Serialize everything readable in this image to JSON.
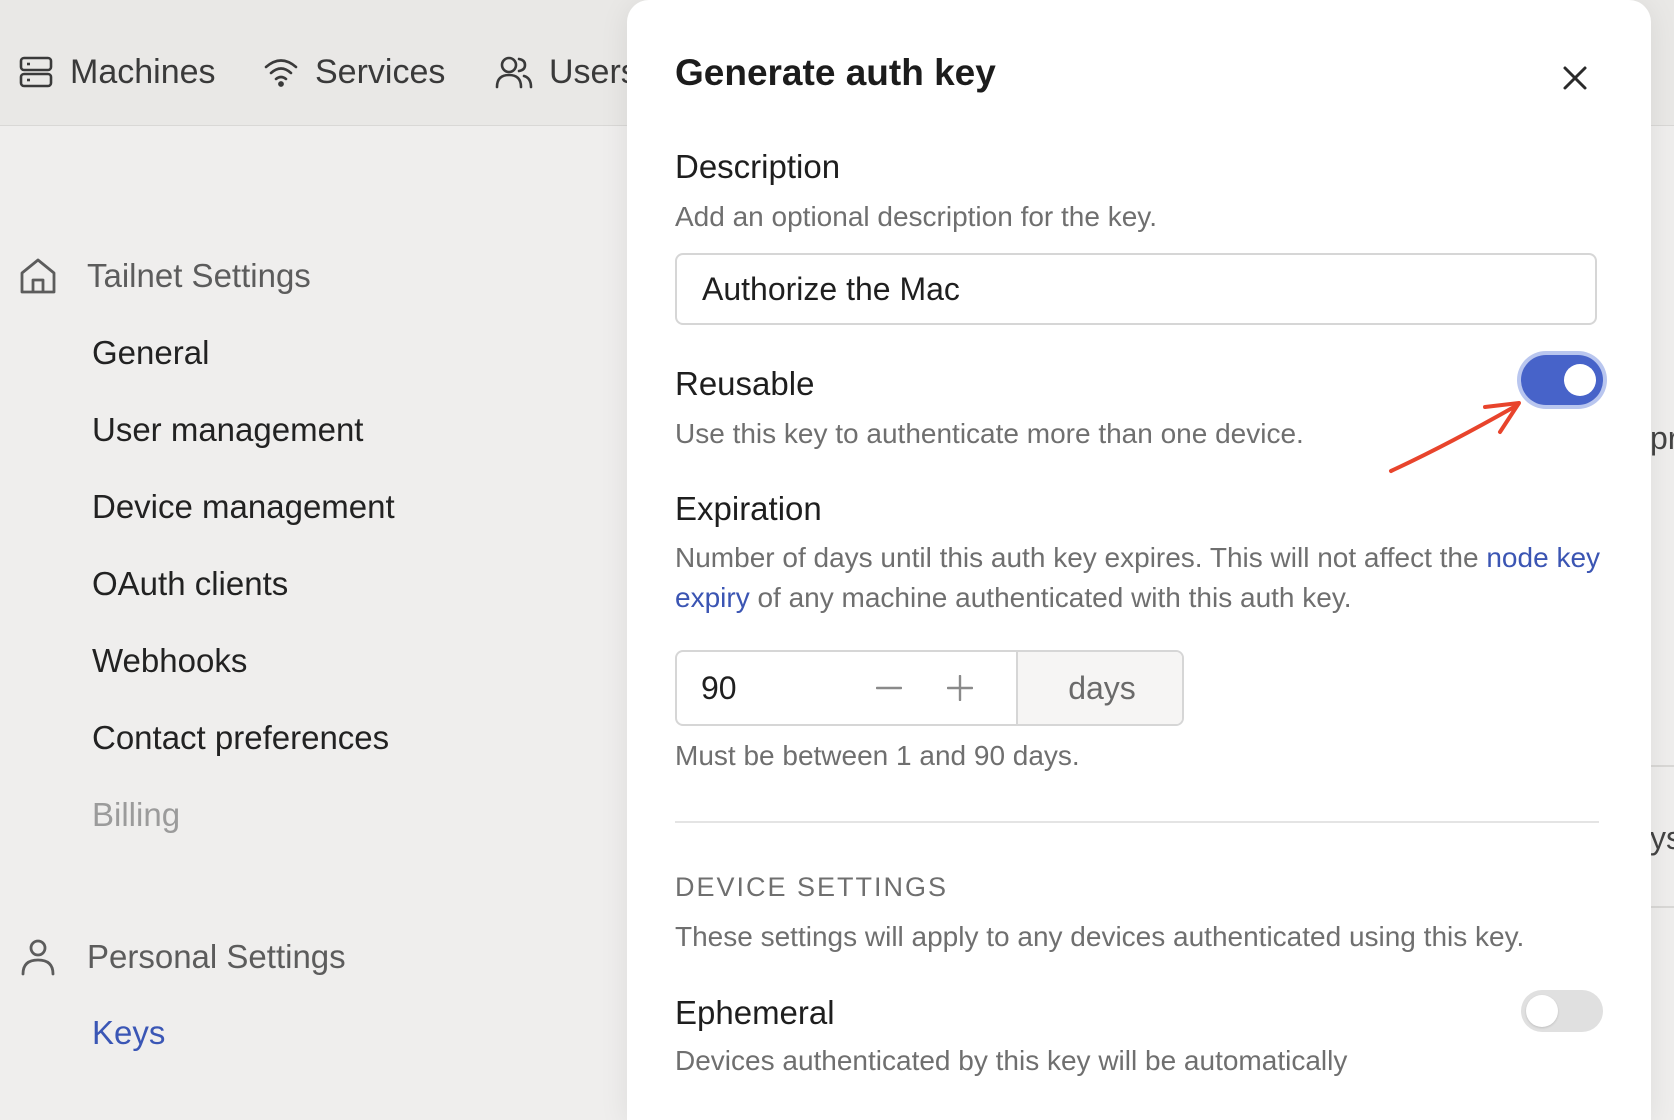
{
  "nav": {
    "machines": "Machines",
    "services": "Services",
    "users": "Users"
  },
  "sidebar": {
    "tailnet_heading": "Tailnet Settings",
    "tailnet_items": [
      "General",
      "User management",
      "Device management",
      "OAuth clients",
      "Webhooks",
      "Contact preferences",
      "Billing"
    ],
    "personal_heading": "Personal Settings",
    "personal_items": [
      "Keys"
    ]
  },
  "background_fragments": {
    "right_1": "pr",
    "right_2": "ys"
  },
  "modal": {
    "title": "Generate auth key",
    "description": {
      "label": "Description",
      "help": "Add an optional description for the key.",
      "value": "Authorize the Mac"
    },
    "reusable": {
      "label": "Reusable",
      "help": "Use this key to authenticate more than one device.",
      "enabled": true
    },
    "expiration": {
      "label": "Expiration",
      "help_before": "Number of days until this auth key expires. This will not affect the ",
      "help_link_1": "node",
      "help_link_2": "key expiry",
      "help_after": " of any machine authenticated with this auth key.",
      "value": "90",
      "unit": "days",
      "hint": "Must be between 1 and 90 days."
    },
    "device_settings": {
      "heading": "DEVICE SETTINGS",
      "help": "These settings will apply to any devices authenticated using this key."
    },
    "ephemeral": {
      "label": "Ephemeral",
      "help": "Devices authenticated by this key will be automatically",
      "enabled": false
    }
  },
  "colors": {
    "accent": "#4763c9",
    "link": "#3b55b3",
    "annotation_arrow": "#e8442c"
  }
}
